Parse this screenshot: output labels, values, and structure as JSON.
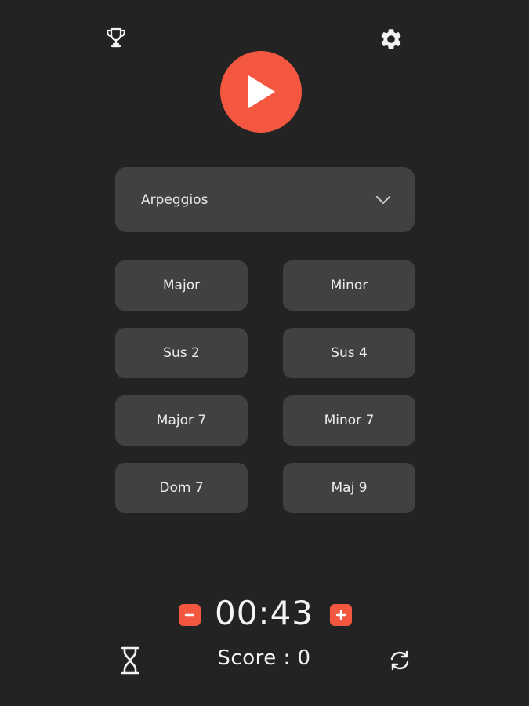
{
  "header": {
    "trophy_icon": "trophy-icon",
    "settings_icon": "gear-icon",
    "play_icon": "play-icon"
  },
  "dropdown": {
    "selected": "Arpeggios",
    "icon": "chevron-down-icon"
  },
  "chords": [
    {
      "label": "Major"
    },
    {
      "label": "Minor"
    },
    {
      "label": "Sus 2"
    },
    {
      "label": "Sus 4"
    },
    {
      "label": "Major 7"
    },
    {
      "label": "Minor 7"
    },
    {
      "label": "Dom 7"
    },
    {
      "label": "Maj 9"
    }
  ],
  "timer": {
    "value": "00:43",
    "decrement_icon": "minus-icon",
    "increment_icon": "plus-icon"
  },
  "footer": {
    "score_text": "Score : 0",
    "hourglass_icon": "hourglass-icon",
    "refresh_icon": "refresh-icon"
  },
  "colors": {
    "background": "#232323",
    "surface": "#414141",
    "accent": "#f4573f",
    "text": "#f2f2f2"
  }
}
